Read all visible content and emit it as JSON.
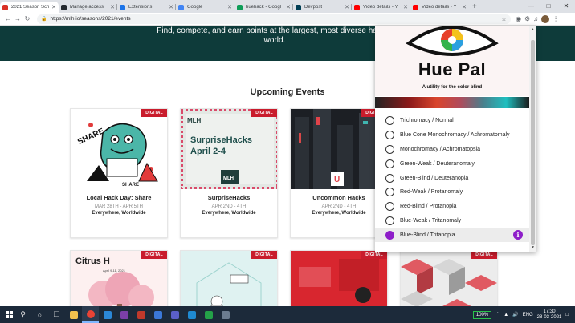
{
  "browser": {
    "tabs": [
      {
        "label": "2021 Season Sch",
        "active": true,
        "color": "#d93025"
      },
      {
        "label": "Manage access",
        "color": "#24292e"
      },
      {
        "label": "Extensions",
        "color": "#1a73e8"
      },
      {
        "label": "Google",
        "color": "#4285f4"
      },
      {
        "label": "huehack - Googl",
        "color": "#0f9d58"
      },
      {
        "label": "Devpost",
        "color": "#003e54"
      },
      {
        "label": "Video details - Y",
        "color": "#ff0000"
      },
      {
        "label": "Video details - Y",
        "color": "#ff0000"
      }
    ],
    "new_tab": "+",
    "url": "https://mlh.io/seasons/2021/events"
  },
  "page": {
    "hero_text": "Find, compete, and earn points at the largest, most diverse hacker world.",
    "section_title": "Upcoming Events",
    "badge_label": "DIGITAL",
    "events": [
      {
        "title": "Local Hack Day: Share",
        "date": "MAR 28TH - APR 5TH",
        "location": "Everywhere, Worldwide"
      },
      {
        "title": "SurpriseHacks",
        "date": "APR 2ND - 4TH",
        "location": "Everywhere, Worldwide"
      },
      {
        "title": "Uncommon Hacks",
        "date": "APR 2ND - 4TH",
        "location": "Everywhere, Worldwide"
      }
    ],
    "art": {
      "share": "SHARE",
      "share_small": "SHARE",
      "mlh": "MLH",
      "surprise_name": "SurpriseHacks",
      "surprise_dates": "April 2-4",
      "uncommon_mark": "U",
      "citrus": "Citrus H",
      "citrus_date": "April 9-11, 2021"
    }
  },
  "extension": {
    "title": "Hue Pal",
    "subtitle": "A utility for the color blind",
    "options": [
      "Trichromacy / Normal",
      "Blue Cone Monochromacy / Achromatomaly",
      "Monochromacy / Achromatopsia",
      "Green-Weak / Deuteranomaly",
      "Green-Blind / Deuteranopia",
      "Red-Weak / Protanomaly",
      "Red-Blind / Protanopia",
      "Blue-Weak / Tritanomaly",
      "Blue-Blind / Tritanopia"
    ],
    "selected_index": 8,
    "info_glyph": "i",
    "accent_color": "#8e1ec9"
  },
  "taskbar": {
    "battery": "100%",
    "language": "ENG",
    "time": "17:30",
    "date": "28-03-2021"
  }
}
